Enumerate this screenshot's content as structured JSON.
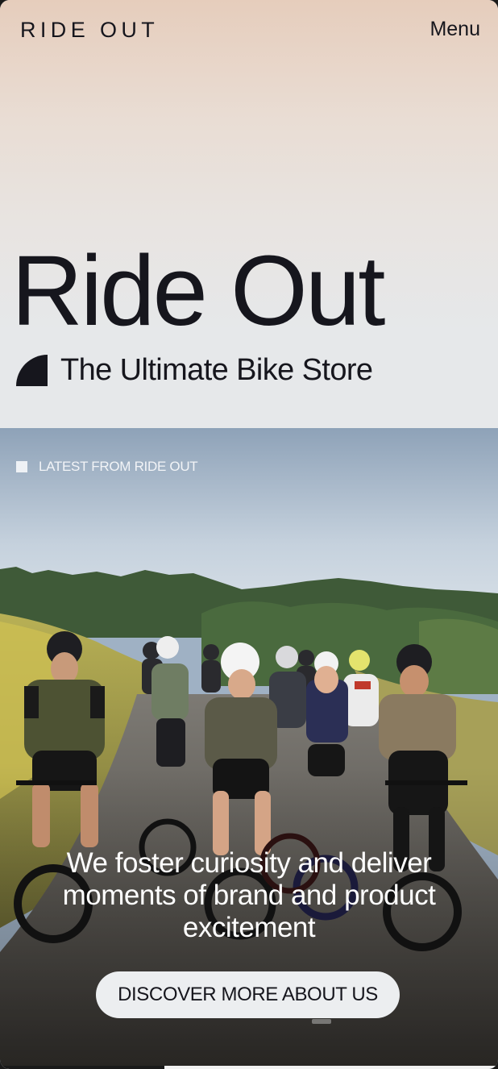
{
  "header": {
    "logo": "RIDE OUT",
    "menu_label": "Menu"
  },
  "hero": {
    "title": "Ride Out",
    "subtitle": "The Ultimate Bike Store",
    "subtitle_icon": "quarter-circle-icon"
  },
  "feature": {
    "eyebrow": "LATEST FROM RIDE OUT",
    "tagline": "We foster curiosity and deliver moments of brand and product excitement",
    "cta_label": "DISCOVER MORE ABOUT US",
    "image": "group-of-cyclists-riding-on-country-road"
  },
  "colors": {
    "ink": "#16161d",
    "hero_top": "#e6cdbc",
    "hero_bottom": "#e6e8ea",
    "button_bg": "#eceef0"
  }
}
